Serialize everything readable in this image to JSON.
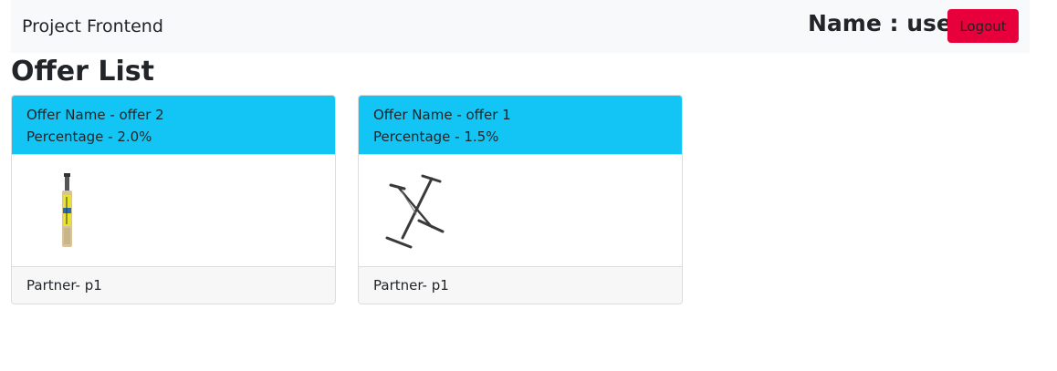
{
  "navbar": {
    "brand": "Project Frontend",
    "user_label": "Name : user",
    "logout_label": "Logout"
  },
  "page": {
    "title": "Offer List"
  },
  "offers": [
    {
      "name_line": "Offer Name - offer 2",
      "percentage_line": "Percentage - 2.0%",
      "image": "cricket-bat-image",
      "partner_line": "Partner- p1"
    },
    {
      "name_line": "Offer Name - offer 1",
      "percentage_line": "Percentage - 1.5%",
      "image": "keyboard-stand-image",
      "partner_line": "Partner- p1"
    }
  ],
  "colors": {
    "navbar_bg": "#f8f9fa",
    "card_header_bg": "#13c5f4",
    "logout_bg": "#e8003d"
  }
}
